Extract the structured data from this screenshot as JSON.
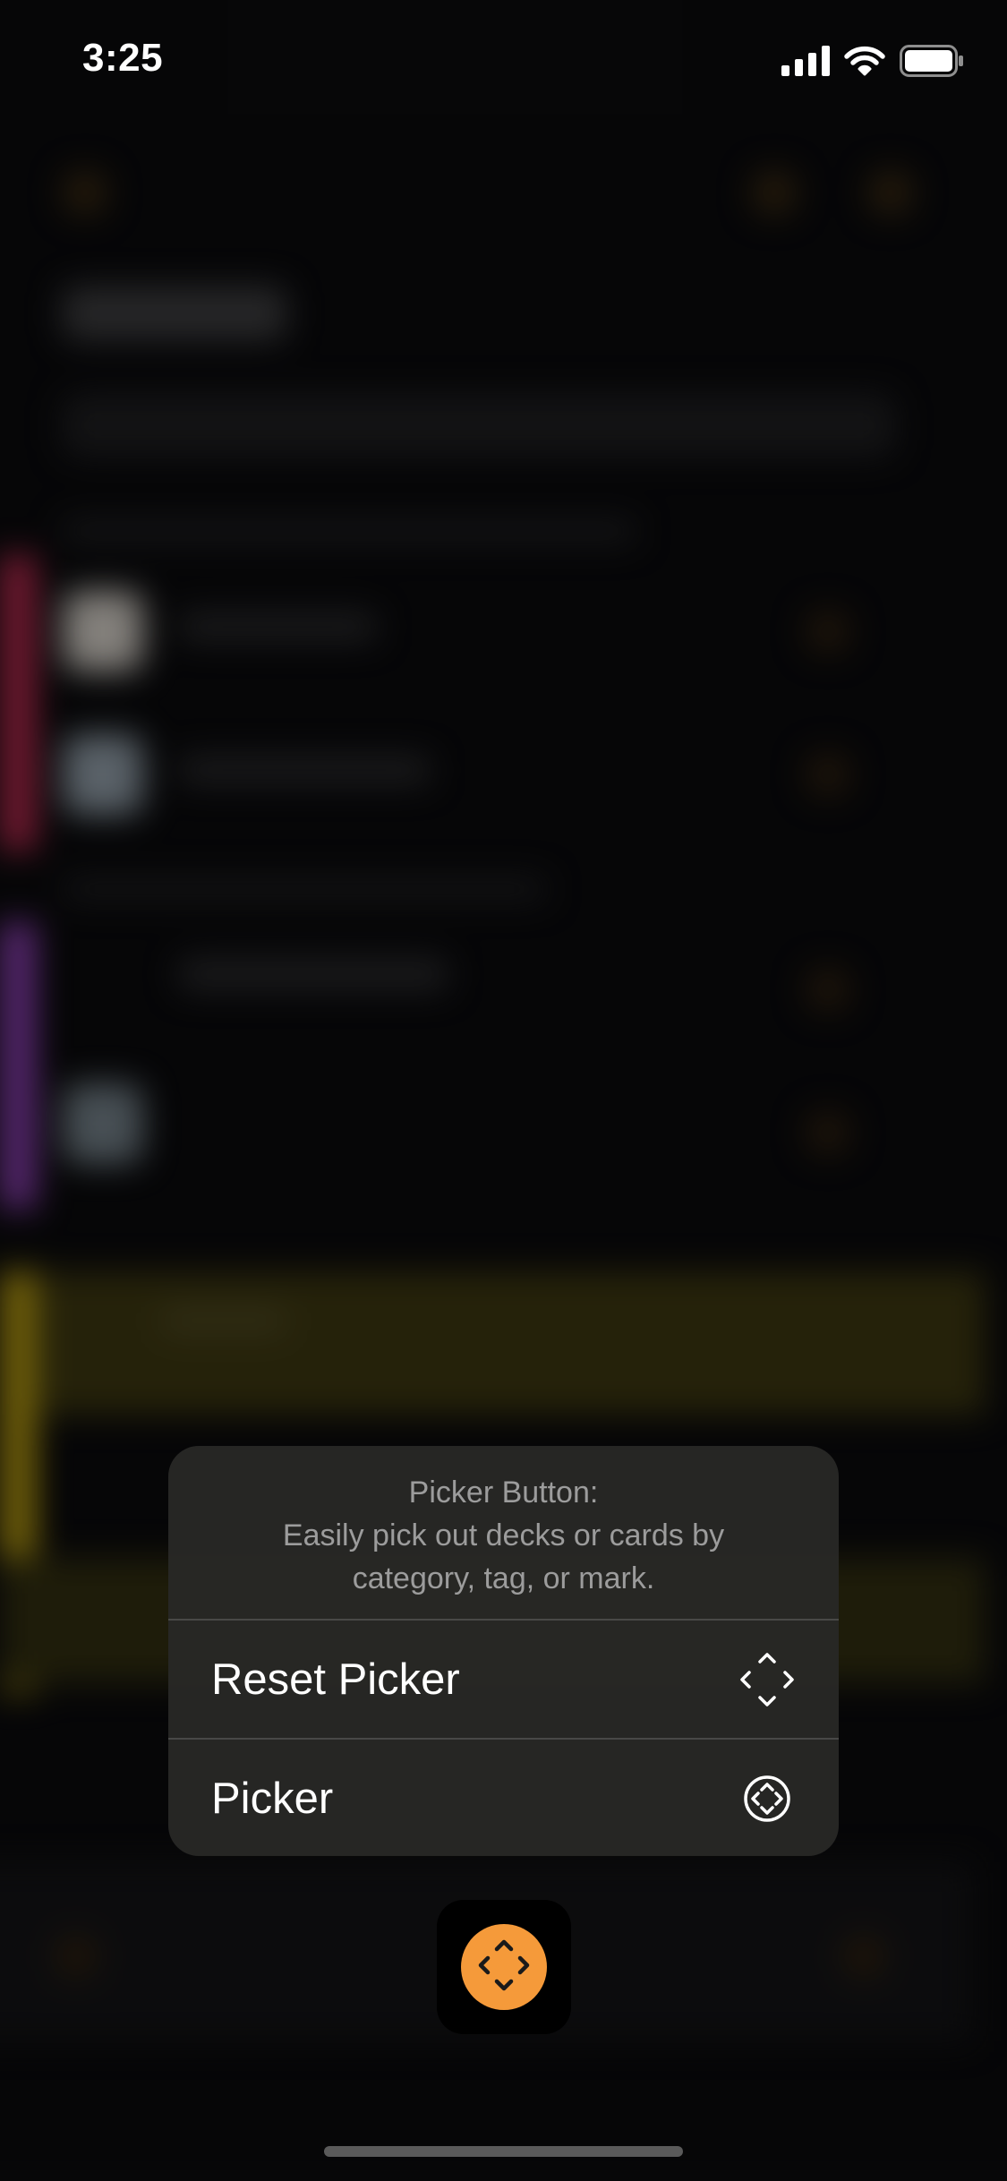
{
  "status_bar": {
    "time": "3:25",
    "icons": [
      "signal-icon",
      "wifi-icon",
      "battery-icon"
    ]
  },
  "context_menu": {
    "header_title": "Picker Button:",
    "header_description": "Easily pick out decks or cards by category, tag, or mark.",
    "items": [
      {
        "label": "Reset Picker",
        "icon": "reset-picker-icon"
      },
      {
        "label": "Picker",
        "icon": "picker-icon"
      }
    ]
  },
  "picker_button": {
    "icon": "picker-diamond-icon"
  },
  "colors": {
    "accent": "#f59a3a",
    "menu_background": "#282826",
    "header_text": "#9c9c9c",
    "background": "#0a0a0c"
  }
}
